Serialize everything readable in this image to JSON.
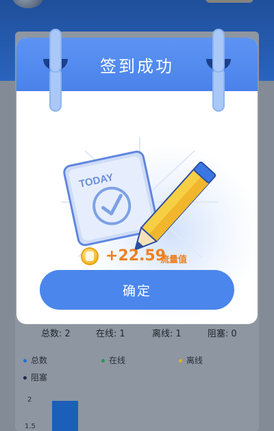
{
  "modal": {
    "title": "签到成功",
    "calendar_label": "TODAY",
    "reward_amount": "+22.59",
    "reward_unit": "流量值",
    "confirm_label": "确定"
  },
  "stats": [
    {
      "label": "总数:",
      "value": "2"
    },
    {
      "label": "在线:",
      "value": "1"
    },
    {
      "label": "离线:",
      "value": "1"
    },
    {
      "label": "阻塞:",
      "value": "0"
    }
  ],
  "chart_data": {
    "type": "bar",
    "legend": [
      {
        "name": "总数",
        "color": "#1f6fd1"
      },
      {
        "name": "在线",
        "color": "#1f9a4a"
      },
      {
        "name": "离线",
        "color": "#e2b31c"
      },
      {
        "name": "阻塞",
        "color": "#1b2a4a"
      }
    ],
    "y_ticks": [
      "2",
      "1.5"
    ],
    "values": [
      2
    ]
  },
  "colors": {
    "header_blue": "#4a82ea",
    "button_blue": "#4a86ec",
    "reward_orange": "#f07f1f"
  }
}
